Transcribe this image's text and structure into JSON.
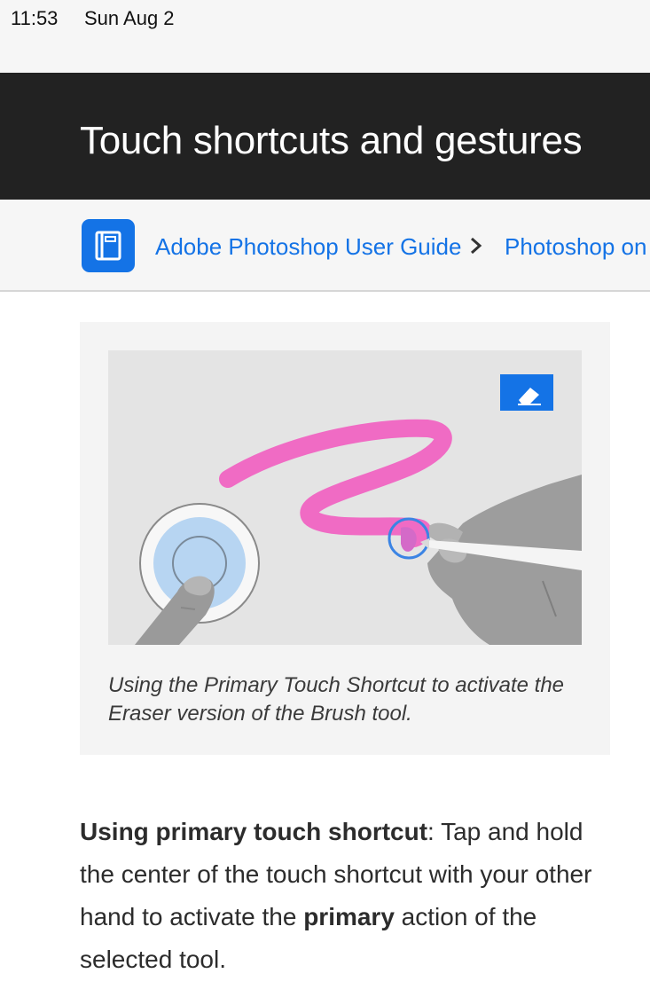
{
  "status_bar": {
    "time": "11:53",
    "date": "Sun Aug 2"
  },
  "page": {
    "title": "Touch shortcuts and gestures"
  },
  "breadcrumb": {
    "icon": "book-icon",
    "items": [
      {
        "label": "Adobe Photoshop User Guide"
      },
      {
        "label": "Photoshop on"
      }
    ],
    "separator_icon": "chevron-right-icon"
  },
  "figure": {
    "caption": "Using the Primary Touch Shortcut to activate the Eraser version of the Brush tool.",
    "eraser_badge_icon": "eraser-icon",
    "colors": {
      "stroke": "#f06bc4",
      "badge": "#1473e6",
      "touch_ring": "#b7d5f2"
    }
  },
  "content": {
    "paragraph": {
      "lead_bold": "Using primary touch shortcut",
      "text_1": ": Tap and hold the center of the touch shortcut with your other hand to activate the ",
      "bold_2": "primary",
      "text_2": " action of the selected tool."
    }
  },
  "colors": {
    "link": "#1473e6",
    "banner": "#222222"
  }
}
